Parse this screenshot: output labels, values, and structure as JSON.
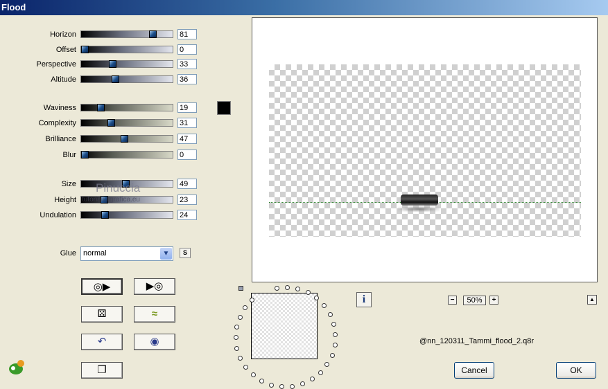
{
  "window": {
    "title": "Flood"
  },
  "sliders": [
    {
      "label": "Horizon",
      "value": "81",
      "fraction": 0.81,
      "style": "blue"
    },
    {
      "label": "Offset",
      "value": "0",
      "fraction": 0.0,
      "style": "blue"
    },
    {
      "label": "Perspective",
      "value": "33",
      "fraction": 0.33,
      "style": "blue"
    },
    {
      "label": "Altitude",
      "value": "36",
      "fraction": 0.36,
      "style": "blue"
    },
    {
      "label": "Waviness",
      "value": "19",
      "fraction": 0.19,
      "style": "sand"
    },
    {
      "label": "Complexity",
      "value": "31",
      "fraction": 0.31,
      "style": "sand"
    },
    {
      "label": "Brilliance",
      "value": "47",
      "fraction": 0.47,
      "style": "sand"
    },
    {
      "label": "Blur",
      "value": "0",
      "fraction": 0.0,
      "style": "sand"
    },
    {
      "label": "Size",
      "value": "49",
      "fraction": 0.49,
      "style": "blue"
    },
    {
      "label": "Height",
      "value": "23",
      "fraction": 0.23,
      "style": "blue"
    },
    {
      "label": "Undulation",
      "value": "24",
      "fraction": 0.24,
      "style": "blue"
    }
  ],
  "color_swatch": {
    "color": "#000000"
  },
  "glue": {
    "label": "Glue",
    "value": "normal",
    "arrow": "▼",
    "side_button": "S"
  },
  "tool_buttons": [
    {
      "name": "randomize-back-button",
      "glyph": "◎▶"
    },
    {
      "name": "randomize-forward-button",
      "glyph": "▶◎"
    },
    {
      "name": "dice-button",
      "glyph": "⚄"
    },
    {
      "name": "wave-button",
      "glyph": "≈"
    },
    {
      "name": "undo-button",
      "glyph": "↶"
    },
    {
      "name": "reset-button",
      "glyph": "◉"
    },
    {
      "name": "copy-button",
      "glyph": "❐"
    }
  ],
  "preview": {
    "info_label": "i"
  },
  "zoom": {
    "minus": "−",
    "value": "50%",
    "plus": "+",
    "up": "▲"
  },
  "filename": "@nn_120311_Tammi_flood_2.q8r",
  "buttons": {
    "cancel": "Cancel",
    "ok": "OK"
  },
  "watermark": {
    "name": "Pinuccia",
    "site": "tutorialidigrafica.eu"
  }
}
